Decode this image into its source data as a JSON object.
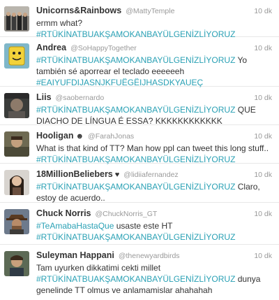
{
  "tweets": [
    {
      "name": "Unicorns&Rainbows",
      "handle": "@MattyTemple",
      "time": "10 dk",
      "parts": [
        {
          "t": "ermm what? "
        },
        {
          "t": "#RTÜKİNATBUAKŞAMOKANBAYÜLGENİZLİYORUZ",
          "tag": true
        }
      ]
    },
    {
      "name": "Andrea",
      "handle": "@SoHappyTogether",
      "time": "10 dk",
      "parts": [
        {
          "t": "#RTÜKİNATBUAKŞAMOKANBAYÜLGENİZLİYORUZ",
          "tag": true
        },
        {
          "t": " Yo también sé aporrear el teclado eeeeeeh "
        },
        {
          "t": "#EAIYUFDIJASNJKFUËGËIJHASDKYAUEÇ",
          "tag": true
        }
      ]
    },
    {
      "name": "Liis",
      "handle": "@saobernardo",
      "time": "10 dk",
      "parts": [
        {
          "t": "#RTÜKİNATBUAKŞAMOKANBAYÜLGENİZLİYORUZ",
          "tag": true
        },
        {
          "t": " QUE DIACHO DE LÍNGUA É ESSA? KKKKKKKKKKKK"
        }
      ]
    },
    {
      "name": "Hooligan",
      "emoji": "☻",
      "handle": "@FarahJonas",
      "time": "10 dk",
      "parts": [
        {
          "t": "What is that kind of TT? Man how ppl can tweet this long stuff.. "
        },
        {
          "t": "#RTÜKİNATBUAKŞAMOKANBAYÜLGENİZLİYORUZ",
          "tag": true
        }
      ]
    },
    {
      "name": "18MillionBeliebers",
      "emoji": "♥",
      "handle": "@lidiiafernandez",
      "time": "10 dk",
      "parts": [
        {
          "t": "#RTÜKİNATBUAKŞAMOKANBAYÜLGENİZLİYORUZ",
          "tag": true
        },
        {
          "t": " Claro, estoy de acuerdo.."
        }
      ]
    },
    {
      "name": "Chuck Norris",
      "handle": "@ChuckNorris_GT",
      "time": "10 dk",
      "parts": [
        {
          "t": "#TeAmabaHastaQue",
          "tag": true
        },
        {
          "t": " usaste este HT "
        },
        {
          "t": "#RTÜKİNATBUAKŞAMOKANBAYÜLGENİZLİYORUZ",
          "tag": true
        }
      ]
    },
    {
      "name": "Suleyman Happani",
      "handle": "@thenewyardbirds",
      "time": "10 dk",
      "parts": [
        {
          "t": "Tam uyurken dikkatimi cekti millet "
        },
        {
          "t": "#RTÜKİNATBUAKŞAMOKANBAYÜLGENİZLİYORUZ",
          "tag": true
        },
        {
          "t": " dunya genelinde TT olmus ve anlamamislar ahahahah"
        }
      ]
    }
  ]
}
